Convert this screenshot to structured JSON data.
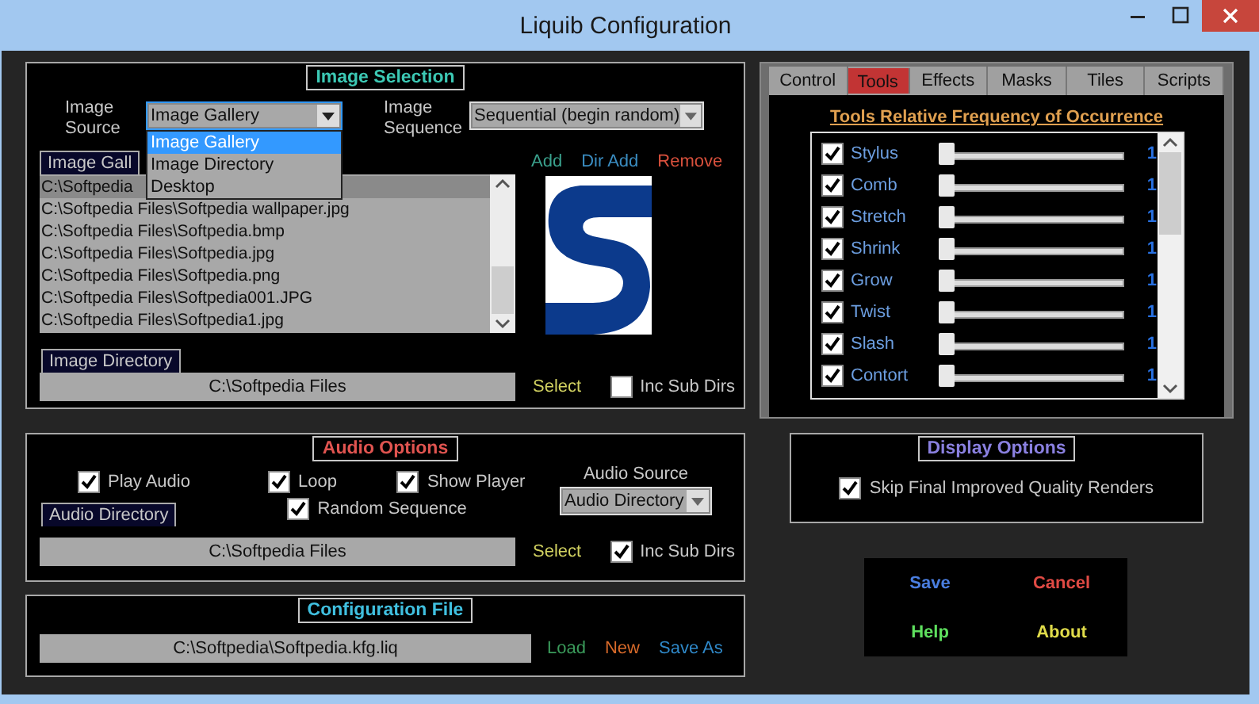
{
  "window": {
    "title": "Liquib Configuration"
  },
  "image_selection": {
    "title": "Image Selection",
    "image_source": {
      "label": "Image Source",
      "value": "Image Gallery",
      "expanded": true,
      "options": [
        {
          "label": "Image Gallery",
          "selected": true
        },
        {
          "label": "Image Directory",
          "selected": false
        },
        {
          "label": "Desktop",
          "selected": false
        }
      ]
    },
    "image_sequence": {
      "label": "Image Sequence",
      "value": "Sequential (begin random)"
    },
    "gallery": {
      "header": "Image Gall",
      "items": [
        {
          "text": "C:\\Softpedia",
          "selected": true
        },
        {
          "text": "C:\\Softpedia Files\\Softpedia wallpaper.jpg",
          "selected": false
        },
        {
          "text": "C:\\Softpedia Files\\Softpedia.bmp",
          "selected": false
        },
        {
          "text": "C:\\Softpedia Files\\Softpedia.jpg",
          "selected": false
        },
        {
          "text": "C:\\Softpedia Files\\Softpedia.png",
          "selected": false
        },
        {
          "text": "C:\\Softpedia Files\\Softpedia001.JPG",
          "selected": false
        },
        {
          "text": "C:\\Softpedia Files\\Softpedia1.jpg",
          "selected": false
        }
      ]
    },
    "actions": [
      {
        "label": "Add",
        "color": "#3aa08c"
      },
      {
        "label": "Dir Add",
        "color": "#3a8cc0"
      },
      {
        "label": "Remove",
        "color": "#d8503c"
      }
    ],
    "directory": {
      "header": "Image Directory",
      "value": "C:\\Softpedia Files",
      "select": "Select",
      "inc_sub_dirs": {
        "label": "Inc Sub Dirs",
        "checked": false
      }
    }
  },
  "tabs": [
    {
      "label": "Control",
      "selected": false
    },
    {
      "label": "Tools",
      "selected": true
    },
    {
      "label": "Effects",
      "selected": false
    },
    {
      "label": "Masks",
      "selected": false
    },
    {
      "label": "Tiles",
      "selected": false
    },
    {
      "label": "Scripts",
      "selected": false
    }
  ],
  "tools": {
    "title": "Tools Relative Frequency of Occurrence",
    "items": [
      {
        "label": "Stylus",
        "checked": true,
        "level": 0,
        "reading": "1"
      },
      {
        "label": "Comb",
        "checked": true,
        "level": 0,
        "reading": "1"
      },
      {
        "label": "Stretch",
        "checked": true,
        "level": 0,
        "reading": "1"
      },
      {
        "label": "Shrink",
        "checked": true,
        "level": 0,
        "reading": "1"
      },
      {
        "label": "Grow",
        "checked": true,
        "level": 0,
        "reading": "1"
      },
      {
        "label": "Twist",
        "checked": true,
        "level": 0,
        "reading": "1"
      },
      {
        "label": "Slash",
        "checked": true,
        "level": 0,
        "reading": "1"
      },
      {
        "label": "Contort",
        "checked": true,
        "level": 0,
        "reading": "1"
      }
    ]
  },
  "audio_options": {
    "title": "Audio Options",
    "checkboxes": [
      {
        "label": "Play Audio",
        "checked": true
      },
      {
        "label": "Loop",
        "checked": true
      },
      {
        "label": "Show Player",
        "checked": true
      },
      {
        "label": "Random Sequence",
        "checked": true
      }
    ],
    "audio_source": {
      "label": "Audio Source",
      "value": "Audio Directory"
    },
    "directory": {
      "header": "Audio Directory",
      "value": "C:\\Softpedia Files",
      "select": "Select",
      "inc_sub_dirs": {
        "label": "Inc Sub Dirs",
        "checked": true
      }
    }
  },
  "display_options": {
    "title": "Display Options",
    "checkbox": {
      "label": "Skip Final Improved Quality Renders",
      "checked": true
    }
  },
  "configuration_file": {
    "title": "Configuration File",
    "path": "C:\\Softpedia\\Softpedia.kfg.liq",
    "actions": [
      {
        "label": "Load",
        "color": "#3a9a5a"
      },
      {
        "label": "New",
        "color": "#d86a2a"
      },
      {
        "label": "Save As",
        "color": "#2f88c8"
      }
    ]
  },
  "buttons": [
    {
      "label": "Save",
      "color": "#4a7ee0"
    },
    {
      "label": "Cancel",
      "color": "#e04a44"
    },
    {
      "label": "Help",
      "color": "#5ee05e"
    },
    {
      "label": "About",
      "color": "#e0dc4a"
    }
  ]
}
